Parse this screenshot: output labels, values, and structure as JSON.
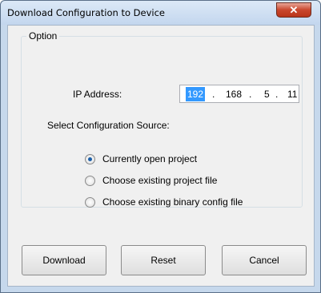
{
  "window": {
    "title": "Download Configuration to Device",
    "close_glyph": "✕"
  },
  "option_group": {
    "label": "Option",
    "ip_label": "IP Address:",
    "ip": {
      "oct1": "192",
      "oct2": "168",
      "oct3": "5",
      "oct4": "11",
      "dot": "."
    },
    "source_label": "Select Configuration Source:",
    "options": [
      {
        "label": "Currently open project",
        "checked": true
      },
      {
        "label": "Choose existing project file",
        "checked": false
      },
      {
        "label": "Choose existing binary config file",
        "checked": false
      }
    ]
  },
  "buttons": {
    "download": "Download",
    "reset": "Reset",
    "cancel": "Cancel"
  }
}
